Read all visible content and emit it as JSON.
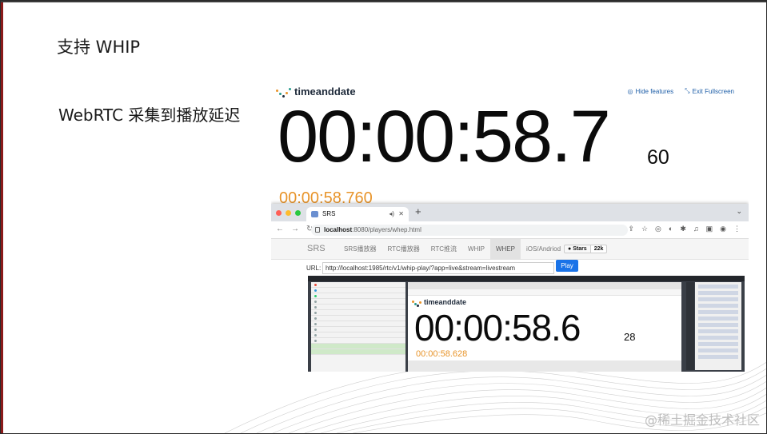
{
  "slide": {
    "title": "支持 WHIP",
    "subtitle": "WebRTC 采集到播放延迟",
    "watermark": "@稀土掘金技术社区"
  },
  "timeanddate": {
    "logo_text": "timeanddate",
    "hide_features": "Hide features",
    "exit_fullscreen": "Exit Fullscreen",
    "clock": "00:00:58.7",
    "clock_ms": "60",
    "clock_orange": "00:00:58.760"
  },
  "browser": {
    "tab_title": "SRS",
    "new_tab": "+",
    "url_host": "localhost",
    "url_rest": ":8080/players/whep.html",
    "traffic_lights": [
      "#ff5f57",
      "#febc2e",
      "#28c840"
    ]
  },
  "srs_nav": {
    "brand": "SRS",
    "items": [
      {
        "label": "SRS播放器",
        "active": false
      },
      {
        "label": "RTC播放器",
        "active": false
      },
      {
        "label": "RTC推流",
        "active": false
      },
      {
        "label": "WHIP",
        "active": false
      },
      {
        "label": "WHEP",
        "active": true
      },
      {
        "label": "iOS/Andriod",
        "active": false
      }
    ],
    "stars_label": "Stars",
    "stars_count": "22k"
  },
  "player": {
    "url_label": "URL:",
    "url_value": "http://localhost:1985/rtc/v1/whip-play/?app=live&stream=livestream",
    "play_button": "Play"
  },
  "nested": {
    "logo_text": "timeanddate",
    "clock": "00:00:58.6",
    "clock_ms": "28",
    "clock_orange": "00:00:58.628"
  },
  "colors": {
    "accent_blue": "#1a73e8",
    "orange": "#e8942a",
    "link_blue": "#1f5fa8"
  }
}
